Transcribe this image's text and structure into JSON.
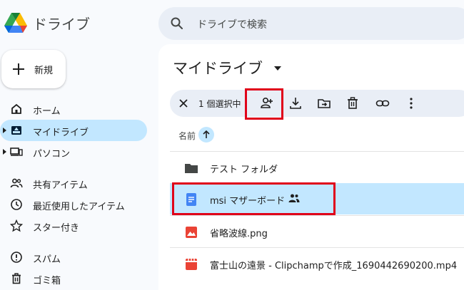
{
  "app": {
    "title": "ドライブ",
    "logo_icon": "google-drive-logo"
  },
  "search": {
    "placeholder": "ドライブで検索"
  },
  "new_button": {
    "label": "新規"
  },
  "sidebar": {
    "items": [
      {
        "label": "ホーム",
        "icon": "home-icon"
      },
      {
        "label": "マイドライブ",
        "icon": "my-drive-icon",
        "active": true
      },
      {
        "label": "パソコン",
        "icon": "computer-icon"
      },
      {
        "label": "共有アイテム",
        "icon": "shared-people-icon"
      },
      {
        "label": "最近使用したアイテム",
        "icon": "clock-icon"
      },
      {
        "label": "スター付き",
        "icon": "star-icon"
      },
      {
        "label": "スパム",
        "icon": "spam-icon"
      },
      {
        "label": "ゴミ箱",
        "icon": "trash-icon"
      }
    ]
  },
  "main": {
    "title": "マイドライブ",
    "selection": {
      "count_label": "1 個選択中"
    },
    "column": {
      "name_header": "名前"
    },
    "files": [
      {
        "name": "テスト フォルダ",
        "icon": "folder-icon"
      },
      {
        "name": "msi マザーボード",
        "icon": "google-docs-icon",
        "selected": true,
        "shared": true
      },
      {
        "name": "省略波線.png",
        "icon": "image-file-icon"
      },
      {
        "name": "富士山の遠景 - Clipchampで作成_1690442690200.mp4",
        "icon": "video-file-icon"
      }
    ]
  },
  "colors": {
    "accent_selected": "#c2e7ff",
    "highlight": "#e0001a",
    "docs_blue": "#4285f4",
    "image_red": "#ea4335"
  }
}
